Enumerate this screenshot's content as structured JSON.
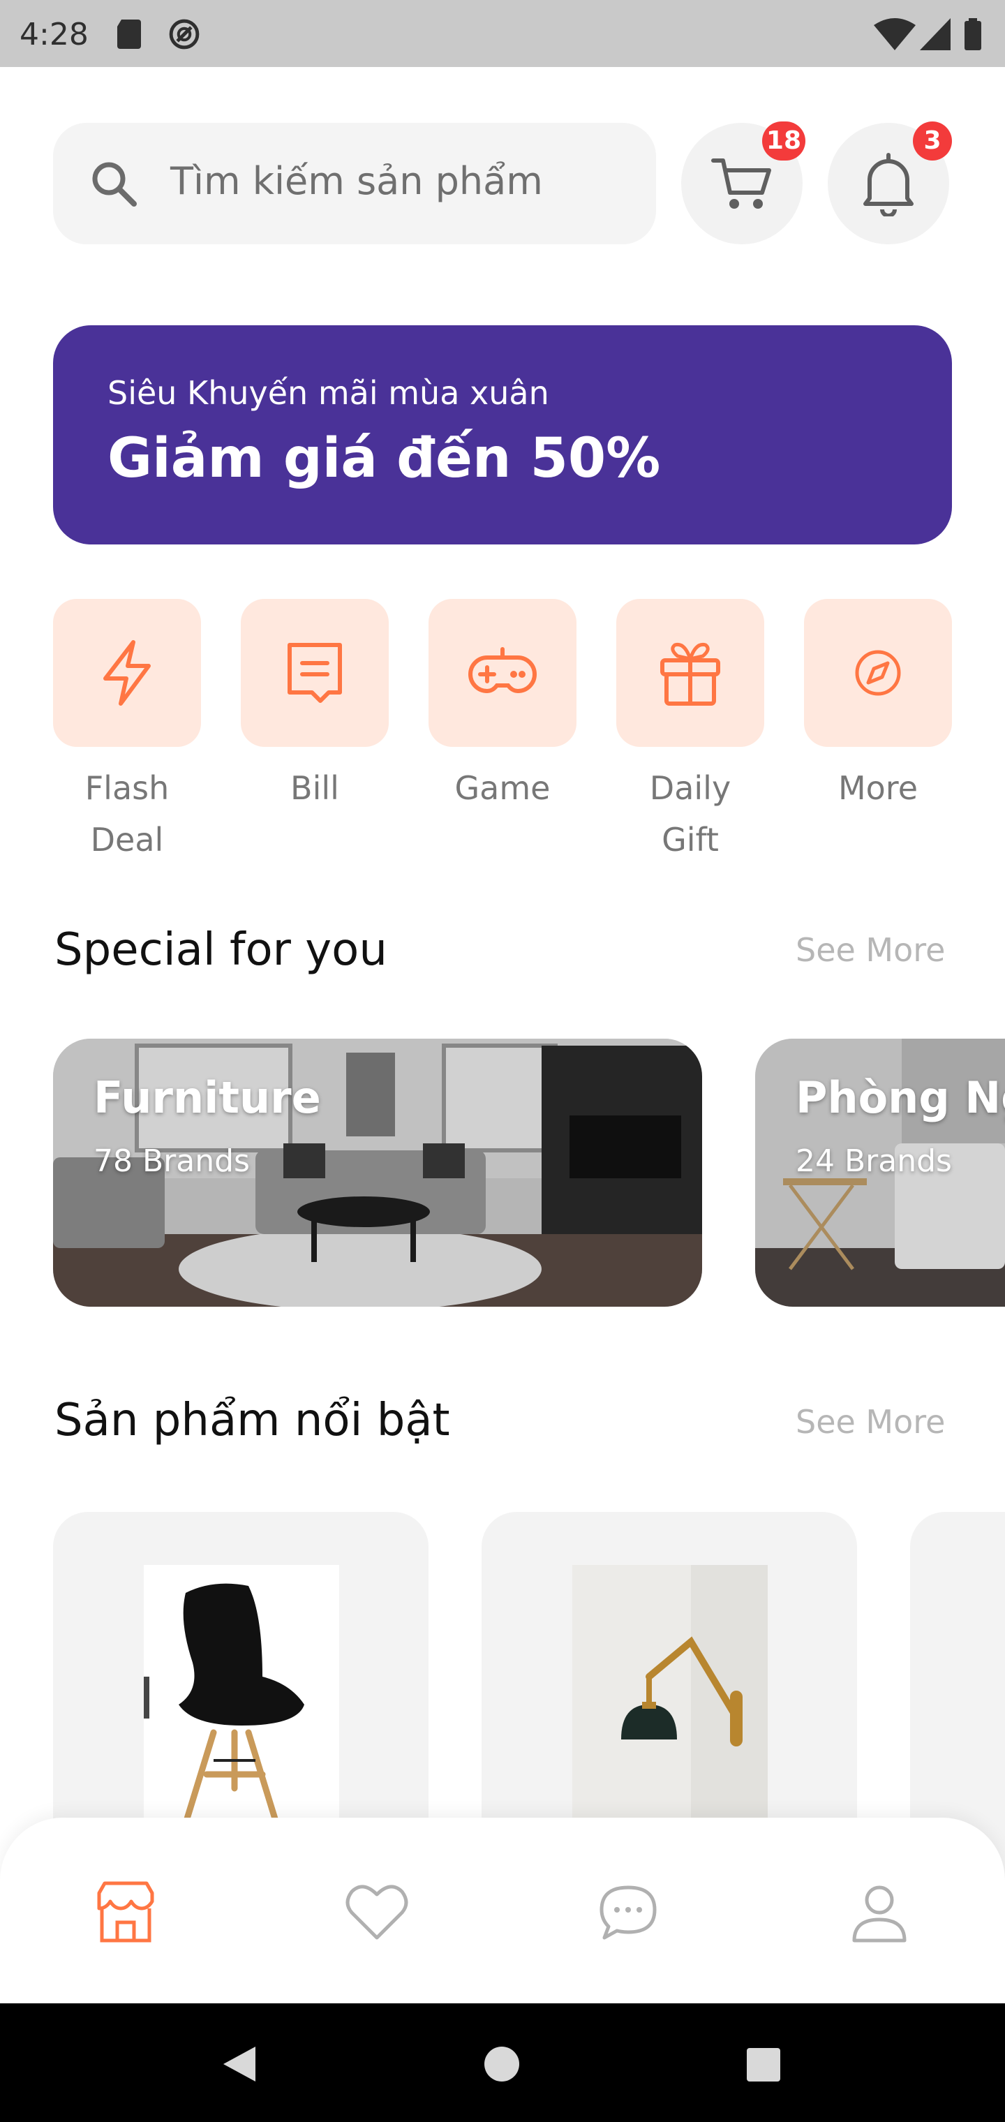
{
  "status_bar": {
    "time": "4:28"
  },
  "search": {
    "placeholder": "Tìm kiếm sản phẩm"
  },
  "header": {
    "cart_count": "18",
    "notification_count": "3"
  },
  "banner": {
    "subtitle": "Siêu Khuyến mãi mùa xuân",
    "title": "Giảm giá đến 50%",
    "color": "#4a3298"
  },
  "categories": [
    {
      "label_line1": "Flash",
      "label_line2": "Deal",
      "icon": "flash-icon"
    },
    {
      "label_line1": "Bill",
      "label_line2": "",
      "icon": "bill-icon"
    },
    {
      "label_line1": "Game",
      "label_line2": "",
      "icon": "game-icon"
    },
    {
      "label_line1": "Daily",
      "label_line2": "Gift",
      "icon": "gift-icon"
    },
    {
      "label_line1": "More",
      "label_line2": "",
      "icon": "discover-icon"
    }
  ],
  "special": {
    "title": "Special for you",
    "see_more": "See More",
    "cards": [
      {
        "title": "Furniture",
        "subtitle": "78 Brands"
      },
      {
        "title": "Phòng Ng",
        "subtitle": "24 Brands"
      }
    ]
  },
  "featured": {
    "title": "Sản phẩm nổi bật",
    "see_more": "See More",
    "products": [
      {
        "image": "chair"
      },
      {
        "image": "wall-lamp"
      }
    ]
  },
  "bottom_nav": [
    {
      "icon": "shop-icon",
      "active": true
    },
    {
      "icon": "heart-icon",
      "active": false
    },
    {
      "icon": "chat-icon",
      "active": false
    },
    {
      "icon": "user-icon",
      "active": false
    }
  ],
  "colors": {
    "accent": "#ff7643",
    "category_bg": "#ffe8de"
  }
}
